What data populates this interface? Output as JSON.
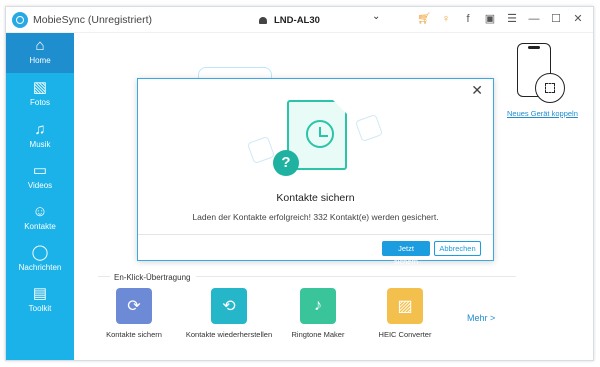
{
  "titlebar": {
    "app_title": "MobieSync (Unregistriert)",
    "device_name": "LND-AL30",
    "icons": [
      "cart-icon",
      "key-icon",
      "facebook-icon",
      "chat-icon",
      "menu-icon",
      "minimize-icon",
      "maximize-icon",
      "close-icon"
    ]
  },
  "sidebar": {
    "items": [
      {
        "label": "Home",
        "icon": "home-icon",
        "active": true
      },
      {
        "label": "Fotos",
        "icon": "photo-icon",
        "active": false
      },
      {
        "label": "Musik",
        "icon": "music-icon",
        "active": false
      },
      {
        "label": "Videos",
        "icon": "video-icon",
        "active": false
      },
      {
        "label": "Kontakte",
        "icon": "contacts-icon",
        "active": false
      },
      {
        "label": "Nachrichten",
        "icon": "messages-icon",
        "active": false
      },
      {
        "label": "Toolkit",
        "icon": "toolkit-icon",
        "active": false
      }
    ]
  },
  "main": {
    "connect_link": "Neues Gerät koppeln",
    "quick_title": "En-Klick-Übertragung",
    "tools": [
      {
        "label": "Kontakte sichern",
        "icon": "backup-contacts-icon"
      },
      {
        "label": "Kontakte wiederherstellen",
        "icon": "restore-contacts-icon"
      },
      {
        "label": "Ringtone Maker",
        "icon": "ringtone-icon"
      },
      {
        "label": "HEIC Converter",
        "icon": "heic-icon"
      }
    ],
    "more_label": "Mehr >"
  },
  "dialog": {
    "title": "Kontakte sichern",
    "message": "Laden der Kontakte erfolgreich! 332 Kontakt(e) werden gesichert.",
    "primary_button": "Jetzt sichern",
    "secondary_button": "Abbrechen"
  },
  "colors": {
    "sidebar": "#1ab2e8",
    "sidebar_active": "#1e8ecf",
    "accent": "#1c9de0",
    "teal": "#2cc4a8"
  }
}
